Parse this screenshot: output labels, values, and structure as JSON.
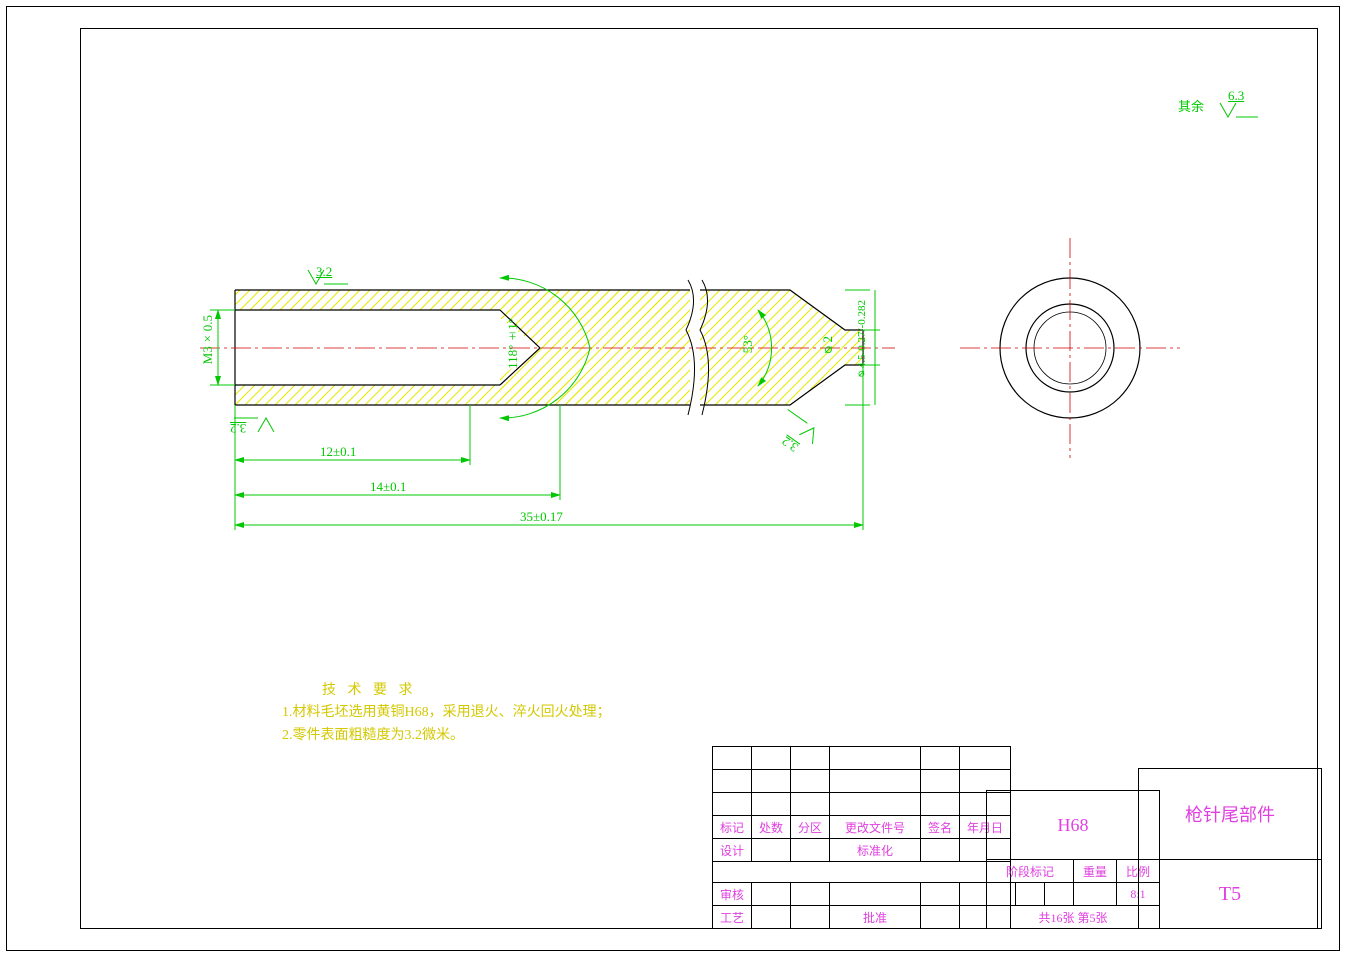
{
  "title_block": {
    "material": "H68",
    "part_name": "枪针尾部件",
    "drawing_no": "T5",
    "stage_mark": "阶段标记",
    "weight": "重量",
    "scale_label": "比例",
    "scale": "8:1",
    "sheet_info": "共16张   第5张",
    "hdr_mark": "标记",
    "hdr_count": "处数",
    "hdr_zone": "分区",
    "hdr_changedoc": "更改文件号",
    "hdr_sign": "签名",
    "hdr_date": "年月日",
    "row_design": "设计",
    "row_standard": "标准化",
    "row_check": "审核",
    "row_tech": "工艺",
    "row_approve": "批准"
  },
  "surface_note": {
    "prefix": "其余",
    "ra": "6.3"
  },
  "roughness": {
    "top": "3.2",
    "bottom": "3.2",
    "taper": "3.2"
  },
  "dims": {
    "thread": "M3×0.5",
    "d12": "12±0.1",
    "d14": "14±0.1",
    "d35": "35±0.17",
    "ang118": "118°±1°",
    "ang53": "53°",
    "dia2": "⌀2",
    "dia45": "⌀4.5-0.27/-0.282"
  },
  "tech_req": {
    "title": "技 术 要 求",
    "line1": "1.材料毛坯选用黄铜H68，采用退火、淬火回火处理；",
    "line2": "2.零件表面粗糙度为3.2微米。"
  }
}
